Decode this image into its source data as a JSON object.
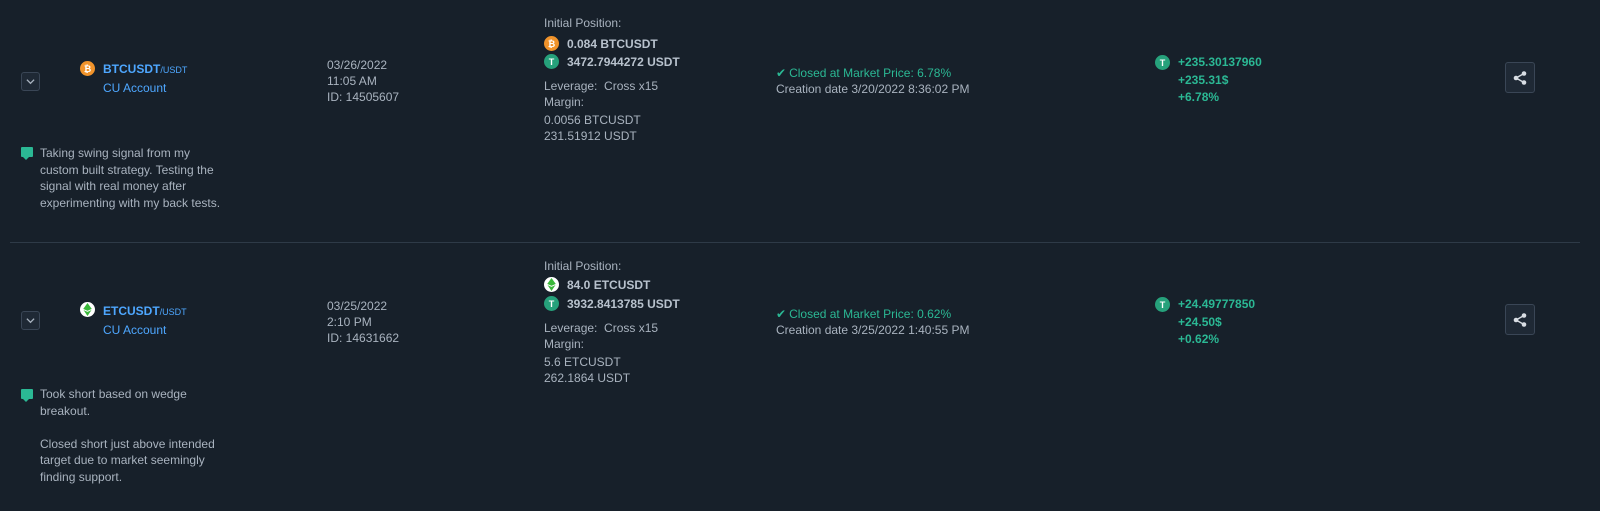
{
  "trades": [
    {
      "pair": "BTCUSDT",
      "quote": "/USDT",
      "account": "CU Account",
      "date": "03/26/2022",
      "time": "11:05 AM",
      "id": "ID: 14505607",
      "initial_label": "Initial Position:",
      "base_amount": "0.084 BTCUSDT",
      "usdt_amount": "3472.7944272 USDT",
      "leverage_label": "Leverage:",
      "leverage_value": "Cross x15",
      "margin_label": "Margin:",
      "margin_base": "0.0056 BTCUSDT",
      "margin_usdt": "231.51912 USDT",
      "status": "Closed at Market Price: 6.78%",
      "creation": "Creation date 3/20/2022 8:36:02 PM",
      "pnl_usdt": "+235.30137960",
      "pnl_usd": "+235.31$",
      "pnl_pct": "+6.78%",
      "note_lines": [
        "Taking swing signal from my",
        "custom built strategy. Testing the",
        "signal with real money after",
        "experimenting with my back tests."
      ]
    },
    {
      "pair": "ETCUSDT",
      "quote": "/USDT",
      "account": "CU Account",
      "date": "03/25/2022",
      "time": "2:10 PM",
      "id": "ID: 14631662",
      "initial_label": "Initial Position:",
      "base_amount": "84.0 ETCUSDT",
      "usdt_amount": "3932.8413785 USDT",
      "leverage_label": "Leverage:",
      "leverage_value": "Cross x15",
      "margin_label": "Margin:",
      "margin_base": "5.6 ETCUSDT",
      "margin_usdt": "262.1864 USDT",
      "status": "Closed at Market Price: 0.62%",
      "creation": "Creation date 3/25/2022 1:40:55 PM",
      "pnl_usdt": "+24.49777850",
      "pnl_usd": "+24.50$",
      "pnl_pct": "+0.62%",
      "note_lines": [
        "Took short based on wedge",
        "breakout.",
        "",
        "Closed short just above intended",
        "target due to market seemingly",
        "finding support."
      ]
    }
  ],
  "icons": {
    "btc": "bitcoin-icon",
    "etc": "ethereum-classic-icon",
    "usdt": "tether-icon",
    "expand": "chevron-down-icon",
    "share": "share-icon",
    "note": "comment-icon"
  },
  "colors": {
    "background": "#17202a",
    "accent_blue": "#4ea7ff",
    "profit_green": "#2bb894",
    "btc_orange": "#f0932b",
    "tether_green": "#26a17b"
  }
}
